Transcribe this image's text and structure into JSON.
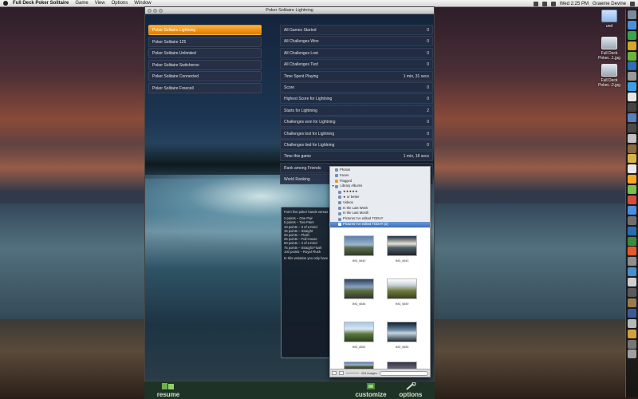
{
  "menubar": {
    "app_name": "Full Deck Poker Solitaire",
    "items": [
      "Game",
      "View",
      "Options",
      "Window"
    ],
    "clock": "Wed 2:25 PM",
    "user": "Graeme Devine"
  },
  "desktop_icons": [
    {
      "name": "und",
      "kind": "folder"
    },
    {
      "name": "Full Deck Poker...1.jpg",
      "kind": "thumb"
    },
    {
      "name": "Full Deck Poker...2.jpg",
      "kind": "thumb"
    }
  ],
  "window": {
    "title": "Poker Solitaire Lightning"
  },
  "variants": [
    {
      "label": "Poker Solitaire Lightning",
      "selected": true
    },
    {
      "label": "Poker Solitaire 125",
      "selected": false
    },
    {
      "label": "Poker Solitaire Unlimited",
      "selected": false
    },
    {
      "label": "Poker Solitaire Switcheroo",
      "selected": false
    },
    {
      "label": "Poker Solitaire Connected",
      "selected": false
    },
    {
      "label": "Poker Solitaire Freecell",
      "selected": false
    }
  ],
  "stats": [
    {
      "label": "All Games Started",
      "value": "0"
    },
    {
      "label": "All Challenges Won",
      "value": "0"
    },
    {
      "label": "All Challenges Lost",
      "value": "0"
    },
    {
      "label": "All Challenges Tied",
      "value": "0"
    },
    {
      "label": "Time Spent Playing",
      "value": "1 min, 31 secs"
    },
    {
      "label": "Score",
      "value": "0"
    },
    {
      "label": "Highest Score for Lightning",
      "value": "0"
    },
    {
      "label": "Starts for Lightning",
      "value": "2"
    },
    {
      "label": "Challenges won for Lightning",
      "value": "0"
    },
    {
      "label": "Challenges lost for Lightning",
      "value": "0"
    },
    {
      "label": "Challenges tied for Lightning",
      "value": "0"
    },
    {
      "label": "Time this game",
      "value": "1 min, 18 secs"
    },
    {
      "label": "Rank among Friends",
      "value": ""
    },
    {
      "label": "World Ranking",
      "value": ""
    }
  ],
  "scoring": {
    "header": "Form five poker hands versus",
    "rules": [
      "2 points – One Pair",
      "5 points – Two Pairs",
      "10 points – 3 of a Kind",
      "15 points – Straight",
      "20 points – Flush",
      "25 points – Full House",
      "50 points – 4 of a Kind",
      "75 points – Straight Flush",
      "100 points – Royal Flush"
    ],
    "footer": "In this variation you only have"
  },
  "photo_browser": {
    "sources": [
      {
        "label": "Photos",
        "indent": 1,
        "selected": false
      },
      {
        "label": "Faces",
        "indent": 1,
        "selected": false
      },
      {
        "label": "Flagged",
        "indent": 1,
        "selected": false
      },
      {
        "label": "Library Albums",
        "indent": 0,
        "selected": false
      },
      {
        "label": "★★★★★",
        "indent": 1,
        "selected": false
      },
      {
        "label": "★ or better",
        "indent": 1,
        "selected": false
      },
      {
        "label": "Videos",
        "indent": 1,
        "selected": false
      },
      {
        "label": "In the Last Week",
        "indent": 1,
        "selected": false
      },
      {
        "label": "In the Last Month",
        "indent": 1,
        "selected": false
      },
      {
        "label": "Pictures I've edited TODAY",
        "indent": 1,
        "selected": false
      },
      {
        "label": "Pictures I've edited TODAY (2)",
        "indent": 1,
        "selected": true
      }
    ],
    "photos": [
      "IMG_6640",
      "IMG_6643",
      "IMG_6646",
      "IMG_6649",
      "IMG_6652",
      "IMG_6655",
      "",
      ""
    ],
    "image_count": "204 images"
  },
  "bottom_bar": {
    "resume": "resume",
    "customize": "customize",
    "options": "options"
  }
}
